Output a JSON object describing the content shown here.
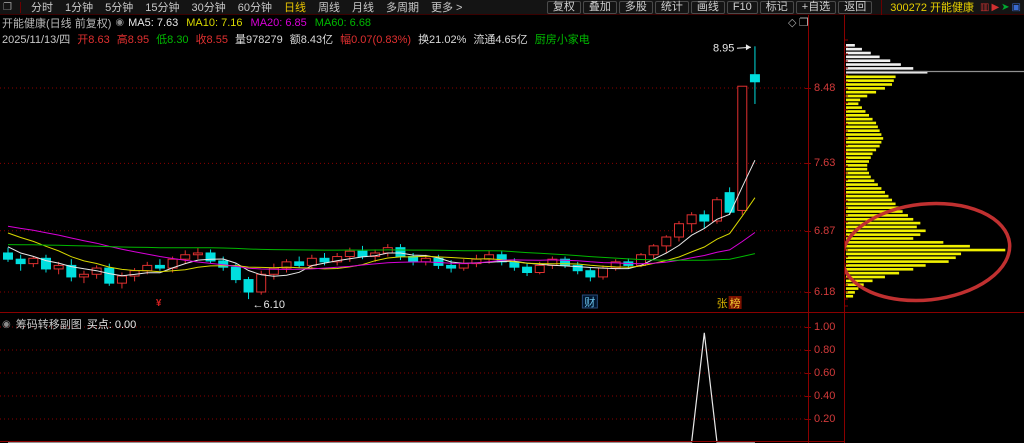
{
  "topbar": {
    "window_icon": "window-icon",
    "left_items": [
      {
        "label": "分时",
        "active": false
      },
      {
        "label": "1分钟",
        "active": false
      },
      {
        "label": "5分钟",
        "active": false
      },
      {
        "label": "15分钟",
        "active": false
      },
      {
        "label": "30分钟",
        "active": false
      },
      {
        "label": "60分钟",
        "active": false
      },
      {
        "label": "日线",
        "active": true
      },
      {
        "label": "周线",
        "active": false
      },
      {
        "label": "月线",
        "active": false
      },
      {
        "label": "多周期",
        "active": false
      },
      {
        "label": "更多 >",
        "active": false
      }
    ],
    "right_buttons": [
      "复权",
      "叠加",
      "多股",
      "统计",
      "画线",
      "F10",
      "标记",
      "+自选",
      "返回"
    ],
    "stock_label": "300272 开能健康"
  },
  "chart_header": {
    "title": "开能健康(日线 前复权)",
    "ma_items": [
      {
        "label": "MA5: 7.63",
        "color": "#e8e8e8"
      },
      {
        "label": "MA10: 7.16",
        "color": "#d8d800"
      },
      {
        "label": "MA20: 6.85",
        "color": "#d800d8"
      },
      {
        "label": "MA60: 6.68",
        "color": "#00b800"
      }
    ]
  },
  "info_line": {
    "parts": [
      {
        "text": "2025/11/13/四",
        "color": "#c8c8c8"
      },
      {
        "text": "开8.63",
        "color": "#e03030"
      },
      {
        "text": "高8.95",
        "color": "#e03030"
      },
      {
        "text": "低8.30",
        "color": "#00b800"
      },
      {
        "text": "收8.55",
        "color": "#e03030"
      },
      {
        "text": "量978279",
        "color": "#d8d8d8"
      },
      {
        "text": "额8.43亿",
        "color": "#d8d8d8"
      },
      {
        "text": "幅0.07(0.83%)",
        "color": "#e03030"
      },
      {
        "text": "换21.02%",
        "color": "#d8d8d8"
      },
      {
        "text": "流通4.65亿",
        "color": "#d8d8d8"
      },
      {
        "text": "厨房小家电",
        "color": "#00b800"
      }
    ]
  },
  "price_axis_labels": [
    "8.48",
    "7.63",
    "6.87",
    "6.18"
  ],
  "sub_panel": {
    "title": "筹码转移副图",
    "buy_label": "买点: 0.00",
    "axis_labels": [
      "1.00",
      "0.80",
      "0.60",
      "0.40",
      "0.20"
    ]
  },
  "colors": {
    "up": "#e03030",
    "down": "#00dede",
    "grid": "#8a0000",
    "axis_text": "#d23a3a",
    "ma5": "#e8e8e8",
    "ma10": "#d8d800",
    "ma20": "#d800d8",
    "ma60": "#00b800",
    "chip_white": "#f0f0f0",
    "chip_yellow": "#f0f000",
    "price_line": "#909090",
    "ellipse": "#c03030",
    "sub_line": "#e8e8e8"
  },
  "chart_data": [
    {
      "type": "candlestick",
      "title": "开能健康 日线 前复权",
      "price_ticks": [
        8.48,
        7.63,
        6.87,
        6.18
      ],
      "ylim": [
        6.05,
        9.1
      ],
      "candles": [
        [
          6.62,
          6.68,
          6.52,
          6.55
        ],
        [
          6.55,
          6.6,
          6.42,
          6.5
        ],
        [
          6.5,
          6.58,
          6.46,
          6.56
        ],
        [
          6.56,
          6.6,
          6.4,
          6.44
        ],
        [
          6.44,
          6.52,
          6.38,
          6.48
        ],
        [
          6.48,
          6.55,
          6.3,
          6.35
        ],
        [
          6.35,
          6.42,
          6.28,
          6.38
        ],
        [
          6.38,
          6.48,
          6.33,
          6.45
        ],
        [
          6.45,
          6.5,
          6.25,
          6.28
        ],
        [
          6.28,
          6.4,
          6.22,
          6.36
        ],
        [
          6.36,
          6.45,
          6.3,
          6.42
        ],
        [
          6.42,
          6.52,
          6.38,
          6.48
        ],
        [
          6.48,
          6.55,
          6.42,
          6.45
        ],
        [
          6.45,
          6.58,
          6.4,
          6.55
        ],
        [
          6.55,
          6.65,
          6.5,
          6.6
        ],
        [
          6.6,
          6.68,
          6.55,
          6.62
        ],
        [
          6.62,
          6.66,
          6.5,
          6.53
        ],
        [
          6.53,
          6.58,
          6.42,
          6.46
        ],
        [
          6.46,
          6.5,
          6.28,
          6.32
        ],
        [
          6.32,
          6.35,
          6.1,
          6.18
        ],
        [
          6.18,
          6.42,
          6.15,
          6.38
        ],
        [
          6.38,
          6.5,
          6.32,
          6.45
        ],
        [
          6.45,
          6.55,
          6.4,
          6.52
        ],
        [
          6.52,
          6.58,
          6.45,
          6.48
        ],
        [
          6.48,
          6.6,
          6.45,
          6.56
        ],
        [
          6.56,
          6.62,
          6.48,
          6.52
        ],
        [
          6.52,
          6.62,
          6.48,
          6.58
        ],
        [
          6.58,
          6.68,
          6.52,
          6.64
        ],
        [
          6.64,
          6.7,
          6.55,
          6.58
        ],
        [
          6.58,
          6.66,
          6.52,
          6.62
        ],
        [
          6.62,
          6.72,
          6.58,
          6.68
        ],
        [
          6.68,
          6.72,
          6.54,
          6.58
        ],
        [
          6.58,
          6.62,
          6.48,
          6.52
        ],
        [
          6.52,
          6.6,
          6.48,
          6.56
        ],
        [
          6.56,
          6.6,
          6.44,
          6.48
        ],
        [
          6.48,
          6.54,
          6.4,
          6.45
        ],
        [
          6.45,
          6.55,
          6.42,
          6.5
        ],
        [
          6.5,
          6.6,
          6.46,
          6.55
        ],
        [
          6.55,
          6.65,
          6.5,
          6.6
        ],
        [
          6.6,
          6.64,
          6.48,
          6.52
        ],
        [
          6.52,
          6.56,
          6.42,
          6.46
        ],
        [
          6.46,
          6.5,
          6.36,
          6.4
        ],
        [
          6.4,
          6.52,
          6.38,
          6.48
        ],
        [
          6.48,
          6.58,
          6.44,
          6.55
        ],
        [
          6.55,
          6.58,
          6.45,
          6.48
        ],
        [
          6.48,
          6.52,
          6.38,
          6.42
        ],
        [
          6.42,
          6.46,
          6.3,
          6.35
        ],
        [
          6.35,
          6.48,
          6.32,
          6.45
        ],
        [
          6.45,
          6.55,
          6.42,
          6.52
        ],
        [
          6.52,
          6.56,
          6.44,
          6.48
        ],
        [
          6.48,
          6.62,
          6.46,
          6.6
        ],
        [
          6.6,
          6.72,
          6.55,
          6.7
        ],
        [
          6.7,
          6.82,
          6.62,
          6.8
        ],
        [
          6.8,
          6.98,
          6.75,
          6.95
        ],
        [
          6.95,
          7.08,
          6.85,
          7.05
        ],
        [
          7.05,
          7.1,
          6.9,
          6.98
        ],
        [
          6.98,
          7.25,
          6.95,
          7.22
        ],
        [
          7.3,
          7.36,
          7.05,
          7.08
        ],
        [
          7.1,
          8.5,
          7.05,
          8.5
        ],
        [
          8.63,
          8.95,
          8.3,
          8.55
        ]
      ],
      "annotations": [
        {
          "kind": "high-callout",
          "text": "8.95",
          "index": 59
        },
        {
          "kind": "low-callout",
          "text": "←6.10",
          "index": 19
        },
        {
          "kind": "event-glyph",
          "text": "¥",
          "index": 12
        },
        {
          "kind": "badge-blue",
          "text": "财",
          "index": 46
        },
        {
          "kind": "badge-hot",
          "text": "张榜",
          "index": 57
        }
      ]
    },
    {
      "type": "volume-profile",
      "name": "筹码分布",
      "white_bars": [
        0.05,
        0.09,
        0.14,
        0.19,
        0.25,
        0.31,
        0.38,
        0.46
      ],
      "yellow_bars": [
        0.28,
        0.27,
        0.26,
        0.22,
        0.17,
        0.12,
        0.08,
        0.07,
        0.09,
        0.11,
        0.13,
        0.15,
        0.17,
        0.18,
        0.19,
        0.2,
        0.21,
        0.2,
        0.19,
        0.17,
        0.15,
        0.14,
        0.13,
        0.12,
        0.12,
        0.13,
        0.14,
        0.16,
        0.18,
        0.2,
        0.22,
        0.24,
        0.26,
        0.28,
        0.3,
        0.32,
        0.35,
        0.38,
        0.42,
        0.4,
        0.45,
        0.42,
        0.38,
        0.55,
        0.7,
        0.9,
        0.65,
        0.62,
        0.58,
        0.45,
        0.38,
        0.3,
        0.22,
        0.15,
        0.1,
        0.07,
        0.05,
        0.04
      ],
      "note": "widths are fraction of panel width; white above current price, yellow below",
      "has_ellipse_annotation": true
    },
    {
      "type": "line",
      "name": "筹码转移副图",
      "yticks": [
        0.2,
        0.4,
        0.6,
        0.8,
        1.0
      ],
      "ylim": [
        0,
        1.1
      ],
      "values": [
        0,
        0,
        0,
        0,
        0,
        0,
        0,
        0,
        0,
        0,
        0,
        0,
        0,
        0,
        0,
        0,
        0,
        0,
        0,
        0,
        0,
        0,
        0,
        0,
        0,
        0,
        0,
        0,
        0,
        0,
        0,
        0,
        0,
        0,
        0,
        0,
        0,
        0,
        0,
        0,
        0,
        0,
        0,
        0,
        0,
        0,
        0,
        0,
        0,
        0,
        0,
        0,
        0,
        0,
        0,
        0.95,
        0,
        0,
        0,
        0
      ]
    }
  ]
}
